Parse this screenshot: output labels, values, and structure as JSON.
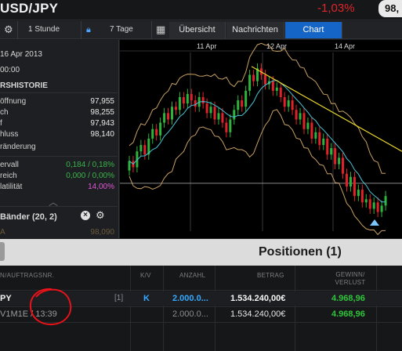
{
  "header": {
    "pair": "USD/JPY",
    "change": "-1,03%",
    "price": "98,"
  },
  "toolbar": {
    "interval": "1 Stunde",
    "range": "7 Tage",
    "tabs": [
      {
        "label": "Übersicht",
        "active": false
      },
      {
        "label": "Nachrichten",
        "active": false
      },
      {
        "label": "Chart",
        "active": true
      }
    ]
  },
  "left": {
    "date": "16 Apr 2013",
    "time": "00:00",
    "history_header": "RSHISTORIE",
    "rows": [
      {
        "label": "öffnung",
        "value": "97,955"
      },
      {
        "label": "ch",
        "value": "98,255"
      },
      {
        "label": "f",
        "value": "97,943"
      },
      {
        "label": "hluss",
        "value": "98,140"
      },
      {
        "label": "ränderung",
        "value": ""
      }
    ],
    "stats": [
      {
        "label": "ervall",
        "value": "0,184 / 0,18%",
        "color": "#39b54a"
      },
      {
        "label": "reich",
        "value": "0,000 / 0,00%",
        "color": "#39b54a"
      },
      {
        "label": "latilität",
        "value": "14,00%",
        "color": "#e058d8"
      }
    ],
    "indicator": "Bänder (20, 2)",
    "bottom_label": "A",
    "bottom_value": "98,090"
  },
  "chart_data": {
    "type": "candlestick",
    "x_ticks": [
      "11 Apr",
      "12 Apr",
      "14 Apr"
    ],
    "candles": [
      {
        "o": 97.55,
        "c": 97.7
      },
      {
        "o": 97.7,
        "c": 97.6
      },
      {
        "o": 97.6,
        "c": 97.85
      },
      {
        "o": 97.85,
        "c": 97.95
      },
      {
        "o": 97.95,
        "c": 97.8
      },
      {
        "o": 97.8,
        "c": 98.05
      },
      {
        "o": 98.05,
        "c": 98.2
      },
      {
        "o": 98.2,
        "c": 98.1
      },
      {
        "o": 98.1,
        "c": 98.3
      },
      {
        "o": 98.3,
        "c": 98.45
      },
      {
        "o": 98.45,
        "c": 98.35
      },
      {
        "o": 98.35,
        "c": 98.55
      },
      {
        "o": 98.55,
        "c": 98.5
      },
      {
        "o": 98.5,
        "c": 98.7
      },
      {
        "o": 98.7,
        "c": 98.6
      },
      {
        "o": 98.6,
        "c": 98.75
      },
      {
        "o": 98.75,
        "c": 98.65
      },
      {
        "o": 98.65,
        "c": 98.55
      },
      {
        "o": 98.55,
        "c": 98.7
      },
      {
        "o": 98.7,
        "c": 98.6
      },
      {
        "o": 98.6,
        "c": 98.45
      },
      {
        "o": 98.45,
        "c": 98.55
      },
      {
        "o": 98.55,
        "c": 98.35
      },
      {
        "o": 98.35,
        "c": 98.45
      },
      {
        "o": 98.45,
        "c": 98.3
      },
      {
        "o": 98.3,
        "c": 98.15
      },
      {
        "o": 98.15,
        "c": 98.35
      },
      {
        "o": 98.35,
        "c": 98.5
      },
      {
        "o": 98.5,
        "c": 98.65
      },
      {
        "o": 98.65,
        "c": 98.55
      },
      {
        "o": 98.55,
        "c": 98.8
      },
      {
        "o": 98.8,
        "c": 99.05
      },
      {
        "o": 99.05,
        "c": 98.95
      },
      {
        "o": 98.95,
        "c": 99.15
      },
      {
        "o": 99.15,
        "c": 99.05
      },
      {
        "o": 99.05,
        "c": 98.9
      },
      {
        "o": 98.9,
        "c": 98.95
      },
      {
        "o": 98.95,
        "c": 98.8
      },
      {
        "o": 98.8,
        "c": 98.85
      },
      {
        "o": 98.85,
        "c": 98.7
      },
      {
        "o": 98.7,
        "c": 98.55
      },
      {
        "o": 98.55,
        "c": 98.65
      },
      {
        "o": 98.65,
        "c": 98.5
      },
      {
        "o": 98.5,
        "c": 98.35
      },
      {
        "o": 98.35,
        "c": 98.45
      },
      {
        "o": 98.45,
        "c": 98.2
      },
      {
        "o": 98.2,
        "c": 98.3
      },
      {
        "o": 98.3,
        "c": 98.05
      },
      {
        "o": 98.05,
        "c": 98.15
      },
      {
        "o": 98.15,
        "c": 97.95
      },
      {
        "o": 97.95,
        "c": 98.05
      },
      {
        "o": 98.05,
        "c": 97.8
      },
      {
        "o": 97.8,
        "c": 97.9
      },
      {
        "o": 97.9,
        "c": 97.65
      },
      {
        "o": 97.65,
        "c": 97.75
      },
      {
        "o": 97.75,
        "c": 97.5
      },
      {
        "o": 97.5,
        "c": 97.3
      },
      {
        "o": 97.3,
        "c": 97.45
      },
      {
        "o": 97.45,
        "c": 97.15
      },
      {
        "o": 97.15,
        "c": 97.25
      },
      {
        "o": 97.25,
        "c": 97.05
      },
      {
        "o": 97.05,
        "c": 97.1
      },
      {
        "o": 97.1,
        "c": 96.95
      },
      {
        "o": 96.95,
        "c": 97.05
      },
      {
        "o": 97.05,
        "c": 96.9
      },
      {
        "o": 96.9,
        "c": 97.0
      },
      {
        "o": 97.0,
        "c": 97.15
      }
    ],
    "y_range": [
      96.6,
      99.4
    ],
    "horizontal_line": 97.35,
    "colors": {
      "up": "#2fb33c",
      "down": "#e0232a",
      "band": "#c8a165",
      "ma": "#4bc3d6",
      "trend": "#e8d62a"
    }
  },
  "positions": {
    "title": "Positionen (1)",
    "columns": [
      "N/AUFTRAGSNR.",
      "K/V",
      "ANZAHL",
      "BETRAG",
      "GEWINN/ VERLUST"
    ],
    "rows": [
      {
        "name": "PY",
        "count": "[1]",
        "kv": "K",
        "amount": "2.000.0...",
        "value": "1.534.240,00€",
        "pl": "4.968,96"
      },
      {
        "name": "V1M1E / 13:39",
        "count": "",
        "kv": "",
        "amount": "2.000.0...",
        "value": "1.534.240,00€",
        "pl": "4.968,96"
      }
    ]
  }
}
